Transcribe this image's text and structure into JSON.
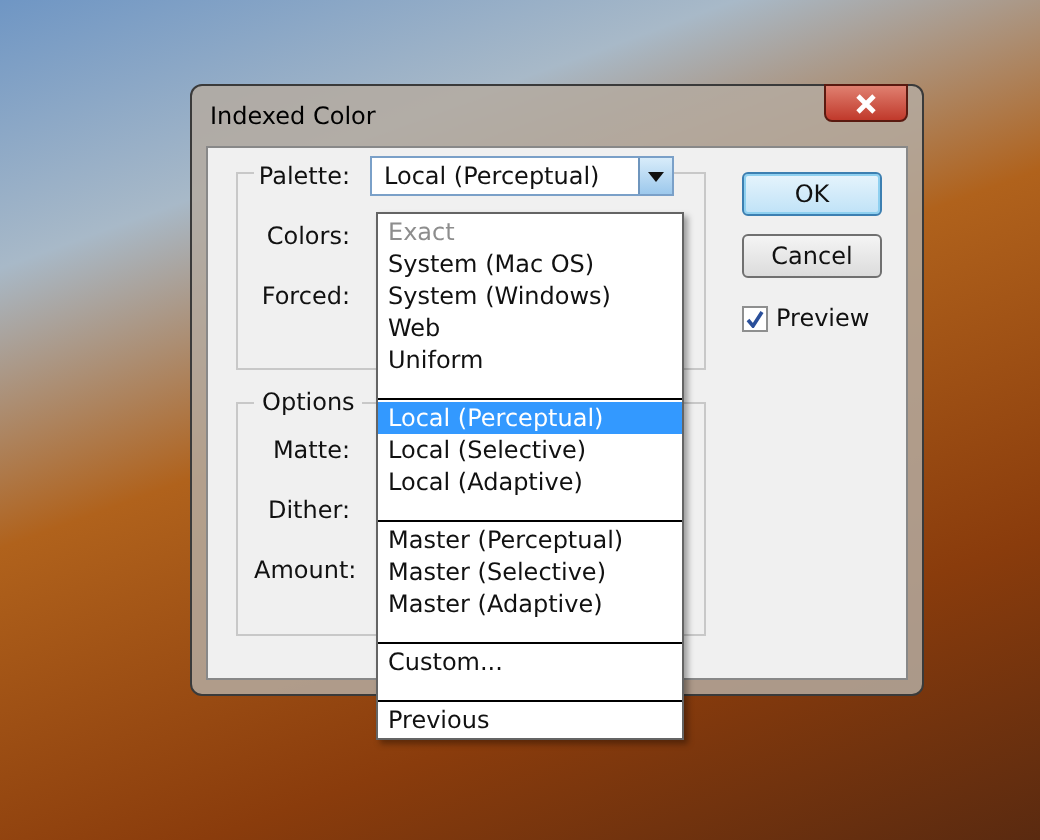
{
  "window": {
    "title": "Indexed Color"
  },
  "palette_group": {
    "label": "Palette:",
    "value": "Local (Perceptual)",
    "fields": [
      "Colors:",
      "Forced:"
    ]
  },
  "options_group": {
    "title": "Options",
    "fields": [
      "Matte:",
      "Dither:",
      "Amount:"
    ]
  },
  "dropdown": {
    "groups": [
      [
        {
          "label": "Exact",
          "selected": false,
          "disabled": true
        },
        {
          "label": "System (Mac OS)",
          "selected": false,
          "disabled": false
        },
        {
          "label": "System (Windows)",
          "selected": false,
          "disabled": false
        },
        {
          "label": "Web",
          "selected": false,
          "disabled": false
        },
        {
          "label": "Uniform",
          "selected": false,
          "disabled": false
        }
      ],
      [
        {
          "label": "Local (Perceptual)",
          "selected": true,
          "disabled": false
        },
        {
          "label": "Local (Selective)",
          "selected": false,
          "disabled": false
        },
        {
          "label": "Local (Adaptive)",
          "selected": false,
          "disabled": false
        }
      ],
      [
        {
          "label": "Master (Perceptual)",
          "selected": false,
          "disabled": false
        },
        {
          "label": "Master (Selective)",
          "selected": false,
          "disabled": false
        },
        {
          "label": "Master (Adaptive)",
          "selected": false,
          "disabled": false
        }
      ],
      [
        {
          "label": "Custom...",
          "selected": false,
          "disabled": false
        }
      ],
      [
        {
          "label": "Previous",
          "selected": false,
          "disabled": false
        }
      ]
    ]
  },
  "buttons": [
    {
      "label": "OK",
      "default": true
    },
    {
      "label": "Cancel",
      "default": false
    }
  ],
  "preview": {
    "label": "Preview",
    "checked": true
  }
}
